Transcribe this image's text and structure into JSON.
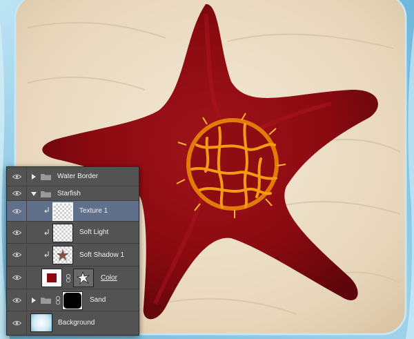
{
  "panel": {
    "layers": [
      {
        "name": "Water Border",
        "kind": "group",
        "expanded": false
      },
      {
        "name": "Starfish",
        "kind": "group",
        "expanded": true
      },
      {
        "name": "Texture 1",
        "kind": "layer",
        "clipped": true,
        "selected": true
      },
      {
        "name": "Soft Light",
        "kind": "layer",
        "clipped": true
      },
      {
        "name": "Soft Shadow 1",
        "kind": "layer",
        "clipped": true
      },
      {
        "name": "Color",
        "kind": "fill",
        "fill_color": "#8b0a0f"
      },
      {
        "name": "Sand",
        "kind": "group",
        "expanded": false,
        "masked": true
      },
      {
        "name": "Background",
        "kind": "layer"
      }
    ]
  },
  "icons": {
    "eye": "eye-icon",
    "folder": "folder-icon",
    "expand": "triangle-icon",
    "link": "chain-link-icon",
    "clip": "clipping-arrow-icon"
  },
  "colors": {
    "starfish": "#8b0a0f",
    "sand": "#e9d9c1",
    "water": "#7fc3e0",
    "panel": "#535353",
    "selected_row": "#60708a"
  }
}
